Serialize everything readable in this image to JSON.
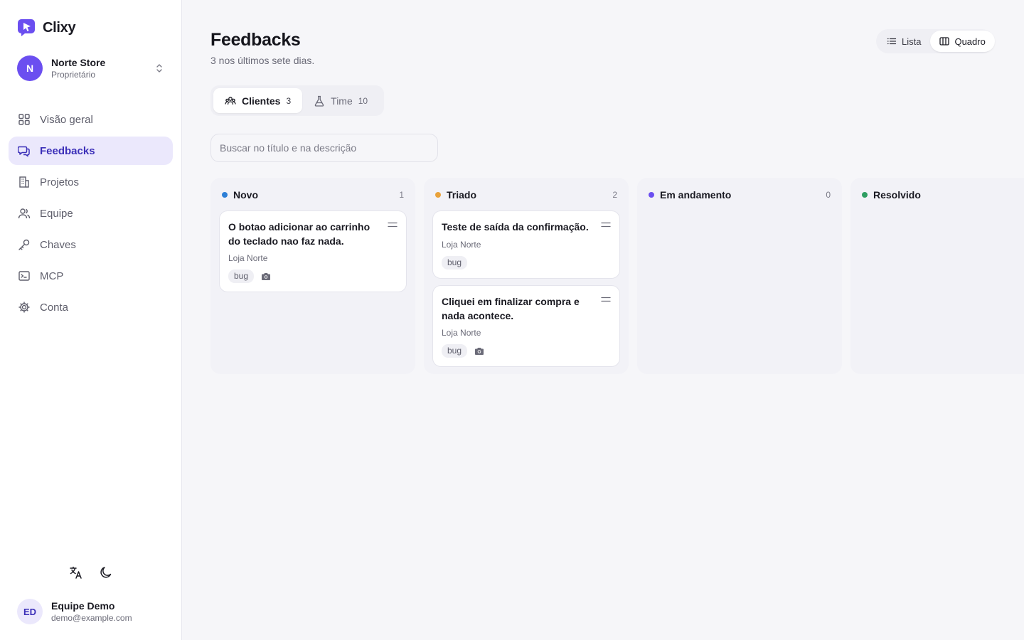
{
  "brand": {
    "name": "Clixy",
    "logo_icon": "clixy-logo-icon",
    "accent": "#6b4ff0"
  },
  "workspace": {
    "avatar_letter": "N",
    "name": "Norte Store",
    "role": "Proprietário"
  },
  "nav": [
    {
      "label": "Visão geral",
      "icon": "grid-icon",
      "active": false
    },
    {
      "label": "Feedbacks",
      "icon": "chat-icon",
      "active": true
    },
    {
      "label": "Projetos",
      "icon": "building-icon",
      "active": false
    },
    {
      "label": "Equipe",
      "icon": "users-icon",
      "active": false
    },
    {
      "label": "Chaves",
      "icon": "key-icon",
      "active": false
    },
    {
      "label": "MCP",
      "icon": "terminal-icon",
      "active": false
    },
    {
      "label": "Conta",
      "icon": "gear-icon",
      "active": false
    }
  ],
  "user": {
    "initials": "ED",
    "name": "Equipe Demo",
    "email": "demo@example.com"
  },
  "header": {
    "title": "Feedbacks",
    "subtitle": "3 nos últimos sete dias."
  },
  "view_toggle": {
    "list_label": "Lista",
    "board_label": "Quadro",
    "selected": "board"
  },
  "segments": [
    {
      "label": "Clientes",
      "count": "3",
      "active": true
    },
    {
      "label": "Time",
      "count": "10",
      "active": false
    }
  ],
  "search": {
    "placeholder": "Buscar no título e na descrição",
    "value": ""
  },
  "columns": [
    {
      "title": "Novo",
      "count": "1",
      "color": "#2d7fd6",
      "cards": [
        {
          "title": "O botao adicionar ao carrinho do teclado nao faz nada.",
          "store": "Loja Norte",
          "tag": "bug",
          "has_screenshot": true
        }
      ]
    },
    {
      "title": "Triado",
      "count": "2",
      "color": "#e9a23b",
      "cards": [
        {
          "title": "Teste de saída da confirmação.",
          "store": "Loja Norte",
          "tag": "bug",
          "has_screenshot": false
        },
        {
          "title": "Cliquei em finalizar compra e nada acontece.",
          "store": "Loja Norte",
          "tag": "bug",
          "has_screenshot": true
        }
      ]
    },
    {
      "title": "Em andamento",
      "count": "0",
      "color": "#6b4ff0",
      "cards": []
    },
    {
      "title": "Resolvido",
      "count": "",
      "color": "#2e9e62",
      "cards": []
    }
  ]
}
